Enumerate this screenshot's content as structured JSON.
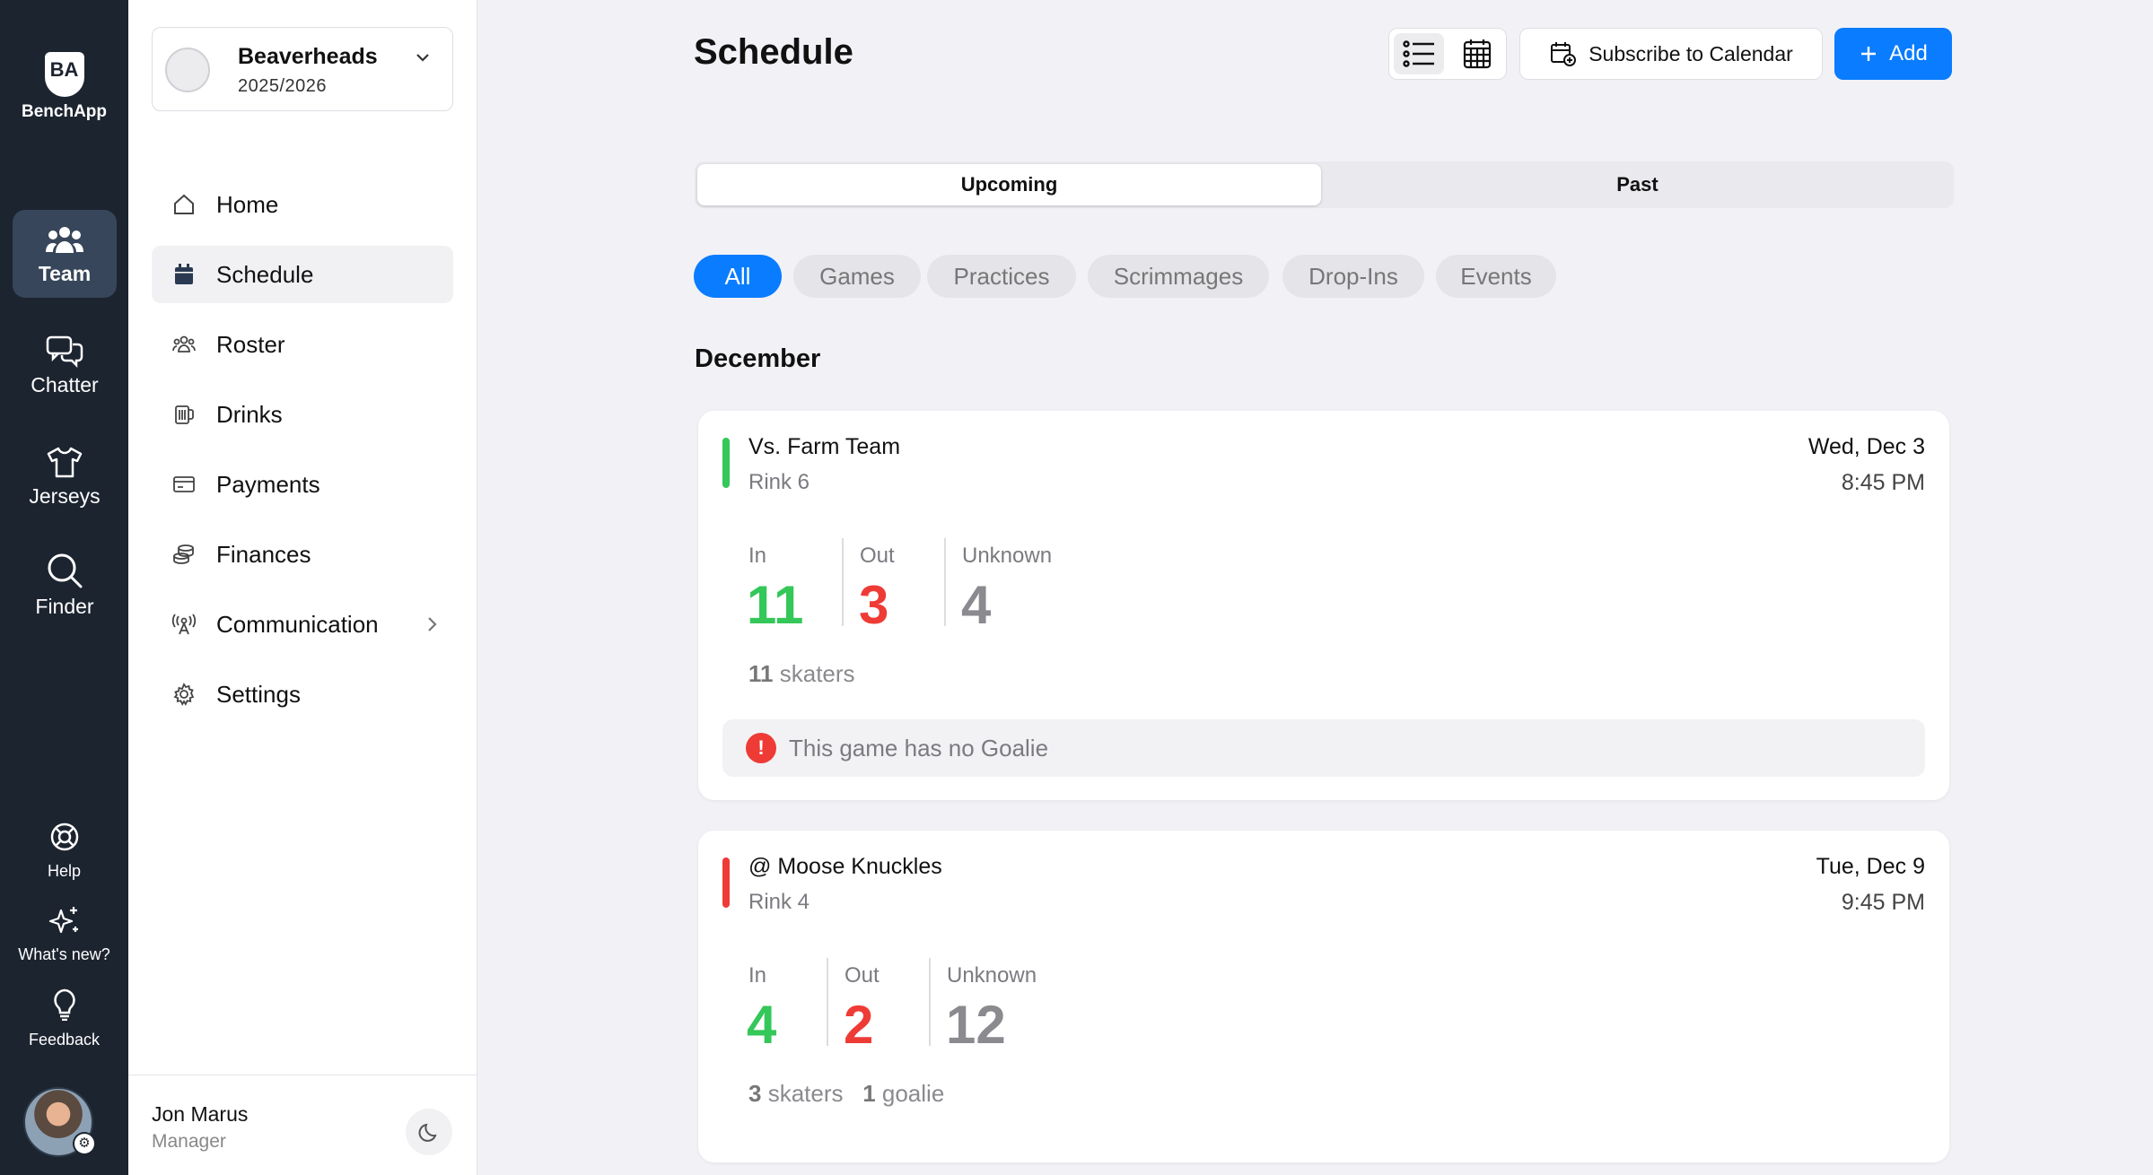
{
  "rail": {
    "brand_mark": "BA",
    "brand_name": "BenchApp",
    "items": [
      {
        "label": "Team"
      },
      {
        "label": "Chatter"
      },
      {
        "label": "Jerseys"
      },
      {
        "label": "Finder"
      }
    ],
    "bottom": [
      {
        "label": "Help"
      },
      {
        "label": "What's new?"
      },
      {
        "label": "Feedback"
      }
    ]
  },
  "team": {
    "name": "Beaverheads",
    "season": "2025/2026"
  },
  "nav": [
    {
      "label": "Home",
      "icon": "home-icon"
    },
    {
      "label": "Schedule",
      "icon": "calendar-icon"
    },
    {
      "label": "Roster",
      "icon": "people-icon"
    },
    {
      "label": "Drinks",
      "icon": "beer-icon"
    },
    {
      "label": "Payments",
      "icon": "card-icon"
    },
    {
      "label": "Finances",
      "icon": "coins-icon"
    },
    {
      "label": "Communication",
      "icon": "broadcast-icon"
    },
    {
      "label": "Settings",
      "icon": "gear-icon"
    }
  ],
  "user": {
    "name": "Jon Marus",
    "role": "Manager"
  },
  "header": {
    "title": "Schedule",
    "subscribe_label": "Subscribe to Calendar",
    "add_label": "Add"
  },
  "segments": {
    "upcoming": "Upcoming",
    "past": "Past"
  },
  "filters": [
    "All",
    "Games",
    "Practices",
    "Scrimmages",
    "Drop-Ins",
    "Events"
  ],
  "month": "December",
  "events": [
    {
      "opponent": "Vs. Farm Team",
      "rink": "Rink 6",
      "date": "Wed, Dec 3",
      "time": "8:45 PM",
      "labels": {
        "in": "In",
        "out": "Out",
        "unknown": "Unknown"
      },
      "in": "11",
      "out": "3",
      "unknown": "4",
      "skaters": "11",
      "skaters_label": "skaters",
      "warning": "This game has no Goalie",
      "warning_icon": "!"
    },
    {
      "opponent": "@ Moose Knuckles",
      "rink": "Rink 4",
      "date": "Tue, Dec 9",
      "time": "9:45 PM",
      "labels": {
        "in": "In",
        "out": "Out",
        "unknown": "Unknown"
      },
      "in": "4",
      "out": "2",
      "unknown": "12",
      "skaters": "3",
      "skaters_label": "skaters",
      "goalies": "1",
      "goalies_label": "goalie"
    }
  ],
  "colors": {
    "accent": "#0a7cff",
    "in": "#34c759",
    "out": "#ee3b35",
    "rail_bg": "#1c2430"
  }
}
